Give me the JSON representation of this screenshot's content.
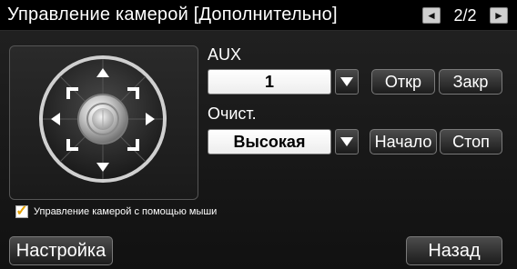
{
  "window": {
    "title": "Управление камерой [Дополнительно]",
    "page_indicator": "2/2",
    "prev_icon": "page-prev-icon",
    "next_icon": "page-next-icon"
  },
  "ptz": {
    "icons": [
      "arrow-up-icon",
      "arrow-down-icon",
      "arrow-left-icon",
      "arrow-right-icon",
      "corner-up-left-icon",
      "corner-up-right-icon",
      "corner-down-left-icon",
      "corner-down-right-icon",
      "center-knob-icon"
    ]
  },
  "mouse_control": {
    "checked": true,
    "label": "Управление камерой с помощью мыши"
  },
  "aux": {
    "label": "AUX",
    "value": "1",
    "open_label": "Откр",
    "close_label": "Закр"
  },
  "cleaning": {
    "label": "Очист.",
    "value": "Высокая",
    "start_label": "Начало",
    "stop_label": "Стоп"
  },
  "footer": {
    "settings_label": "Настройка",
    "back_label": "Назад"
  },
  "colors": {
    "background": "#111111",
    "title_bar": "#000000",
    "checkbox_check": "#e5a000",
    "button_text": "#ffffff"
  }
}
